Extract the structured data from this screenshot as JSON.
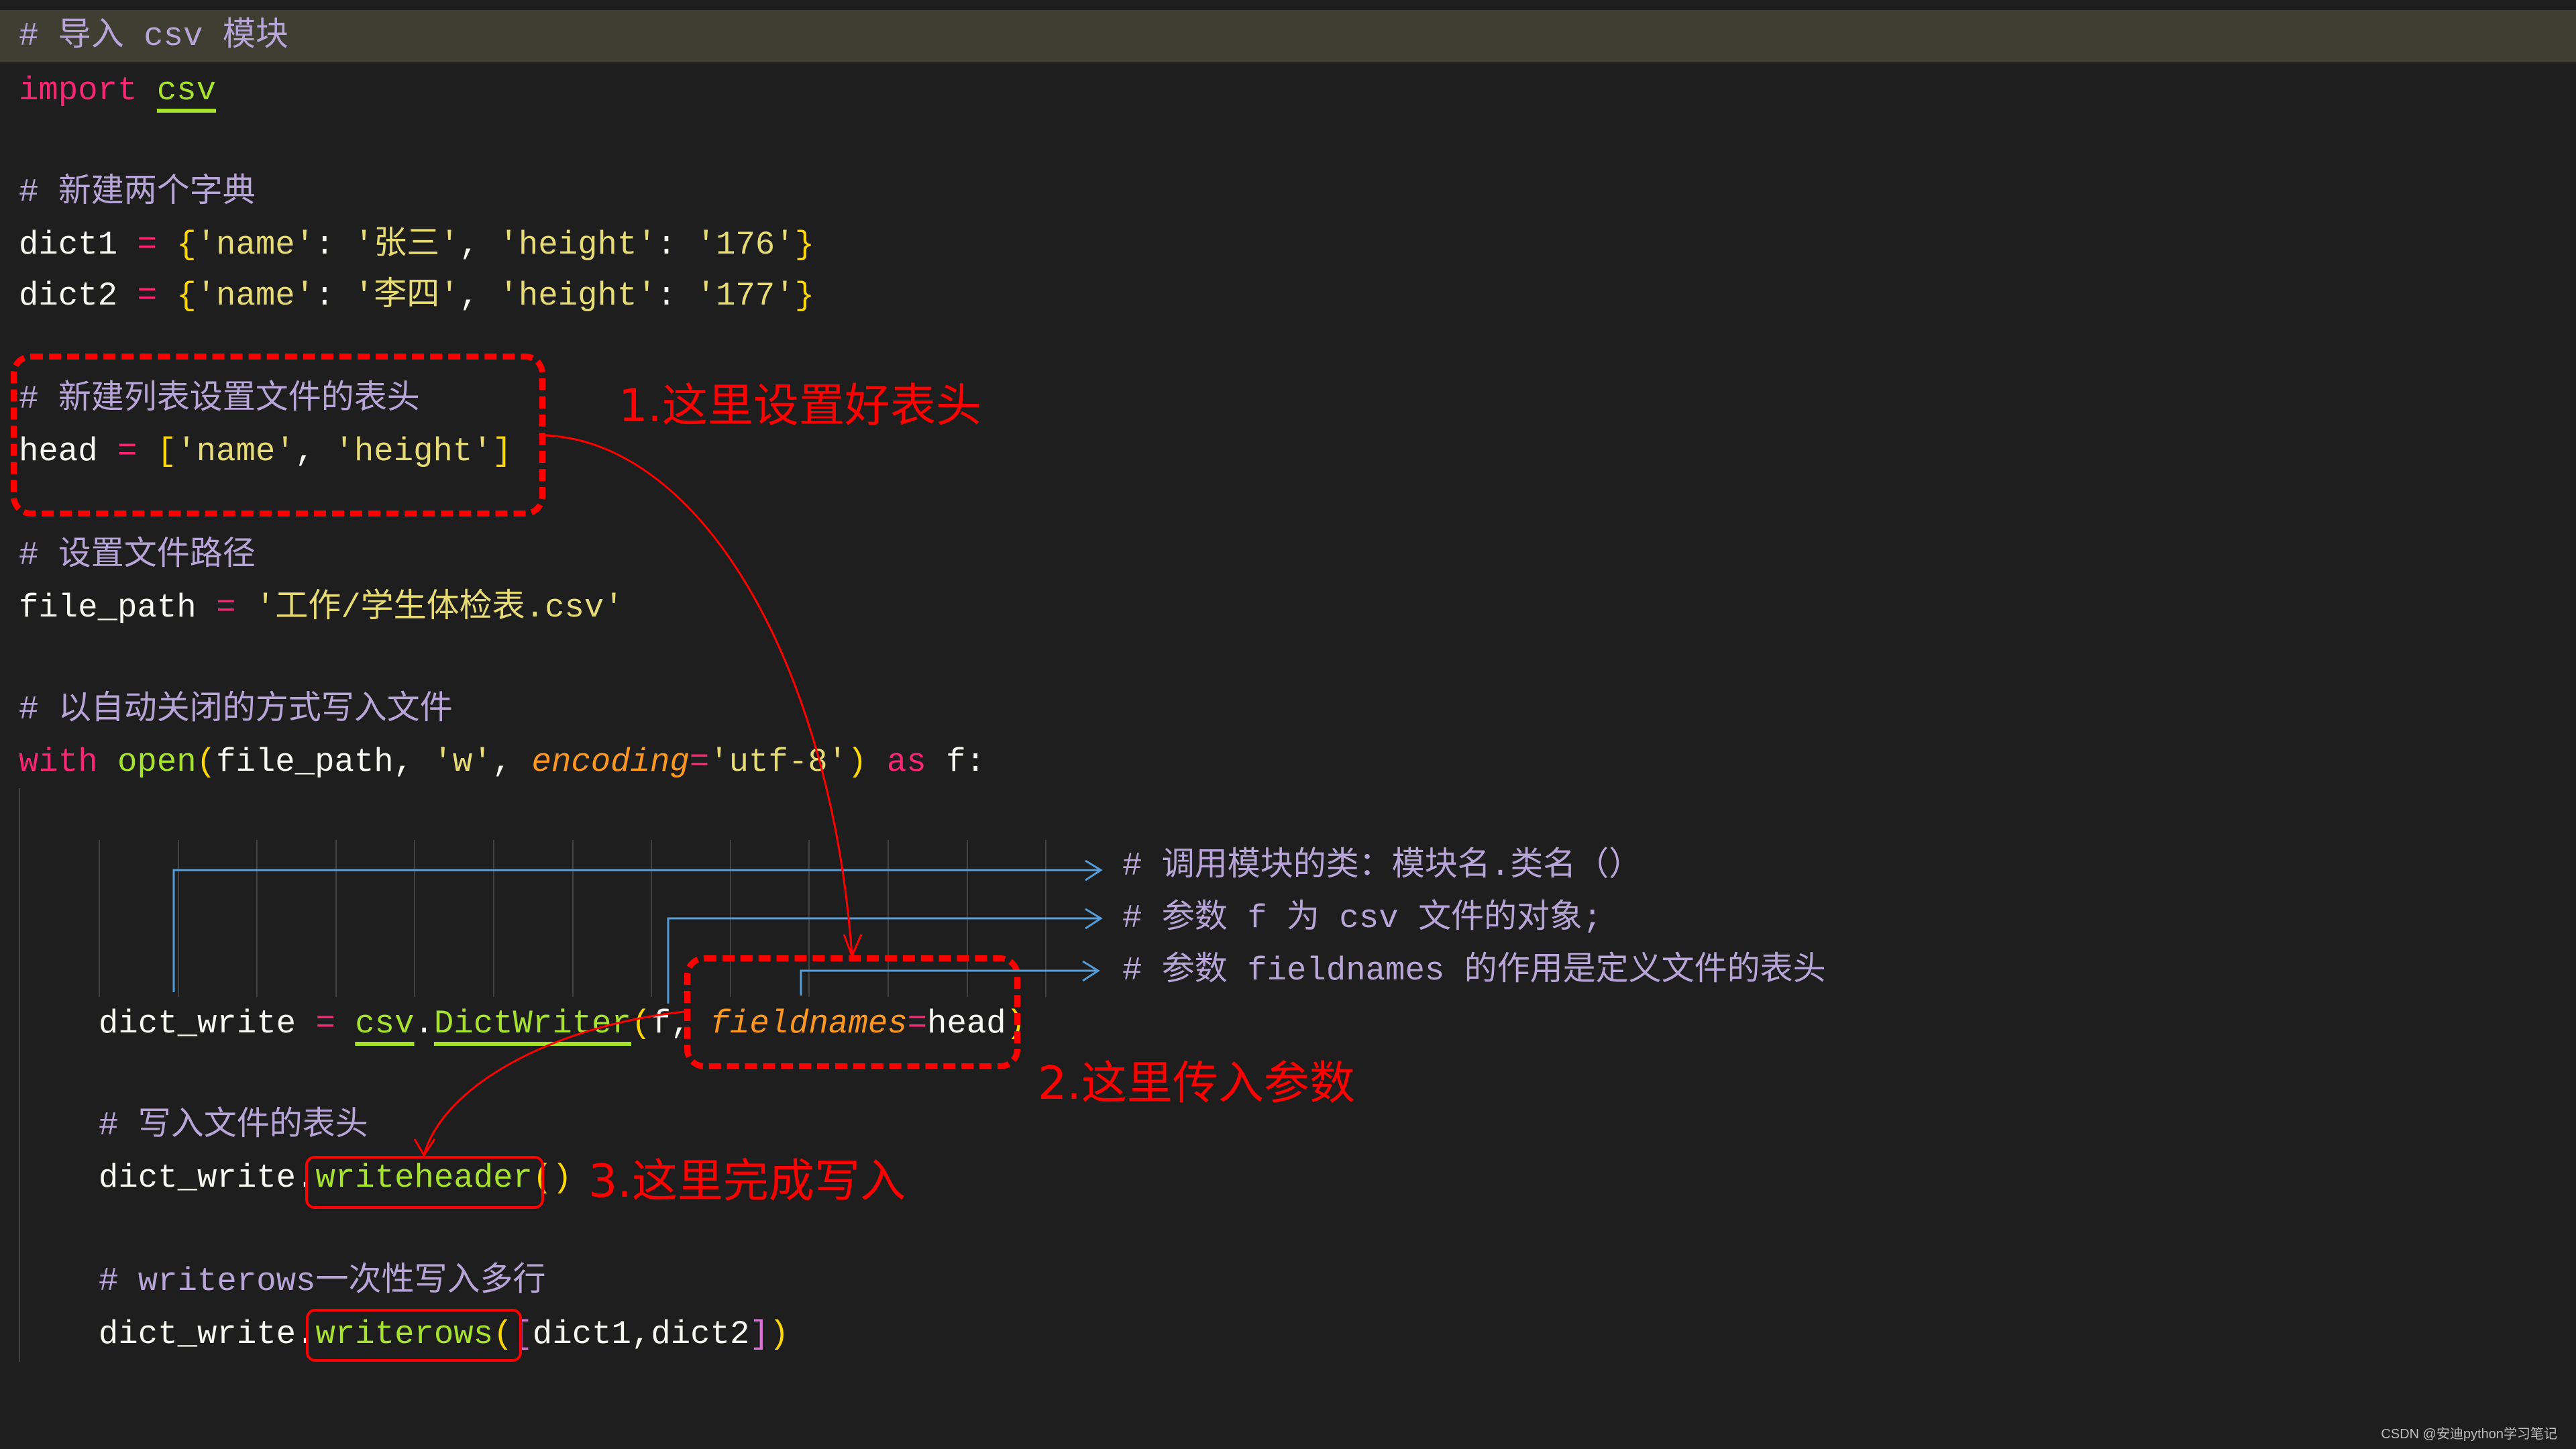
{
  "editor": {
    "highlighted_line": 0,
    "colors": {
      "background": "#1e1e1e",
      "line_highlight": "#3e3e32",
      "annotation_red": "#ff0000",
      "connector_blue": "#569cd6"
    }
  },
  "code_lines": [
    {
      "indent": 0,
      "tokens": [
        {
          "t": "# 导入 csv 模块",
          "c": "comment"
        }
      ]
    },
    {
      "indent": 0,
      "tokens": [
        {
          "t": "import",
          "c": "keyword"
        },
        {
          "t": " ",
          "c": "plain"
        },
        {
          "t": "csv",
          "c": "func-u"
        }
      ]
    },
    {
      "indent": 0,
      "tokens": [
        {
          "t": "# 新建两个字典",
          "c": "comment"
        }
      ]
    },
    {
      "indent": 0,
      "tokens": [
        {
          "t": "dict1 ",
          "c": "plain"
        },
        {
          "t": "=",
          "c": "op"
        },
        {
          "t": " ",
          "c": "plain"
        },
        {
          "t": "{",
          "c": "bracket"
        },
        {
          "t": "'name'",
          "c": "string"
        },
        {
          "t": ": ",
          "c": "plain"
        },
        {
          "t": "'张三'",
          "c": "string"
        },
        {
          "t": ", ",
          "c": "plain"
        },
        {
          "t": "'height'",
          "c": "string"
        },
        {
          "t": ": ",
          "c": "plain"
        },
        {
          "t": "'176'",
          "c": "string"
        },
        {
          "t": "}",
          "c": "bracket"
        }
      ]
    },
    {
      "indent": 0,
      "tokens": [
        {
          "t": "dict2 ",
          "c": "plain"
        },
        {
          "t": "=",
          "c": "op"
        },
        {
          "t": " ",
          "c": "plain"
        },
        {
          "t": "{",
          "c": "bracket"
        },
        {
          "t": "'name'",
          "c": "string"
        },
        {
          "t": ": ",
          "c": "plain"
        },
        {
          "t": "'李四'",
          "c": "string"
        },
        {
          "t": ", ",
          "c": "plain"
        },
        {
          "t": "'height'",
          "c": "string"
        },
        {
          "t": ": ",
          "c": "plain"
        },
        {
          "t": "'177'",
          "c": "string"
        },
        {
          "t": "}",
          "c": "bracket"
        }
      ]
    },
    {
      "indent": 0,
      "tokens": [
        {
          "t": "# 新建列表设置文件的表头",
          "c": "comment"
        }
      ]
    },
    {
      "indent": 0,
      "tokens": [
        {
          "t": "head ",
          "c": "plain"
        },
        {
          "t": "=",
          "c": "op"
        },
        {
          "t": " ",
          "c": "plain"
        },
        {
          "t": "[",
          "c": "bracket"
        },
        {
          "t": "'name'",
          "c": "string"
        },
        {
          "t": ", ",
          "c": "plain"
        },
        {
          "t": "'height'",
          "c": "string"
        },
        {
          "t": "]",
          "c": "bracket"
        }
      ]
    },
    {
      "indent": 0,
      "tokens": [
        {
          "t": "# 设置文件路径",
          "c": "comment"
        }
      ]
    },
    {
      "indent": 0,
      "tokens": [
        {
          "t": "file_path ",
          "c": "plain"
        },
        {
          "t": "=",
          "c": "op"
        },
        {
          "t": " ",
          "c": "plain"
        },
        {
          "t": "'工作/学生体检表.csv'",
          "c": "string"
        }
      ]
    },
    {
      "indent": 0,
      "tokens": [
        {
          "t": "# 以自动关闭的方式写入文件",
          "c": "comment"
        }
      ]
    },
    {
      "indent": 0,
      "tokens": [
        {
          "t": "with",
          "c": "keyword"
        },
        {
          "t": " ",
          "c": "plain"
        },
        {
          "t": "open",
          "c": "func"
        },
        {
          "t": "(",
          "c": "bracket"
        },
        {
          "t": "file_path, ",
          "c": "plain"
        },
        {
          "t": "'w'",
          "c": "string"
        },
        {
          "t": ", ",
          "c": "plain"
        },
        {
          "t": "encoding",
          "c": "param"
        },
        {
          "t": "=",
          "c": "op"
        },
        {
          "t": "'utf-8'",
          "c": "string"
        },
        {
          "t": ")",
          "c": "bracket"
        },
        {
          "t": " ",
          "c": "plain"
        },
        {
          "t": "as",
          "c": "keyword"
        },
        {
          "t": " f:",
          "c": "plain"
        }
      ]
    },
    {
      "indent": 1,
      "tokens": [
        {
          "t": "dict_write ",
          "c": "plain"
        },
        {
          "t": "=",
          "c": "op"
        },
        {
          "t": " ",
          "c": "plain"
        },
        {
          "t": "csv",
          "c": "func-u"
        },
        {
          "t": ".",
          "c": "plain"
        },
        {
          "t": "DictWriter",
          "c": "func-u"
        },
        {
          "t": "(",
          "c": "bracket"
        },
        {
          "t": "f, ",
          "c": "plain"
        },
        {
          "t": "fieldnames",
          "c": "param"
        },
        {
          "t": "=",
          "c": "op"
        },
        {
          "t": "head",
          "c": "plain"
        },
        {
          "t": ")",
          "c": "bracket"
        }
      ]
    },
    {
      "indent": 1,
      "tokens": [
        {
          "t": "# 写入文件的表头",
          "c": "comment"
        }
      ]
    },
    {
      "indent": 1,
      "tokens": [
        {
          "t": "dict_write.",
          "c": "plain"
        },
        {
          "t": "writeheader",
          "c": "func"
        },
        {
          "t": "()",
          "c": "bracket"
        }
      ]
    },
    {
      "indent": 1,
      "tokens": [
        {
          "t": "# writerows一次性写入多行",
          "c": "comment"
        }
      ]
    },
    {
      "indent": 1,
      "tokens": [
        {
          "t": "dict_write.",
          "c": "plain"
        },
        {
          "t": "writerows",
          "c": "func"
        },
        {
          "t": "(",
          "c": "bracket"
        },
        {
          "t": "[",
          "c": "bracket2"
        },
        {
          "t": "dict1,dict2",
          "c": "plain"
        },
        {
          "t": "]",
          "c": "bracket2"
        },
        {
          "t": ")",
          "c": "bracket"
        }
      ]
    }
  ],
  "inline_annotations": [
    "# 调用模块的类：模块名.类名（）",
    "# 参数 f 为 csv 文件的对象;",
    "# 参数 fieldnames 的作用是定义文件的表头"
  ],
  "callouts": {
    "step1": "1.这里设置好表头",
    "step2": "2.这里传入参数",
    "step3": "3.这里完成写入"
  },
  "watermark": "CSDN @安迪python学习笔记"
}
